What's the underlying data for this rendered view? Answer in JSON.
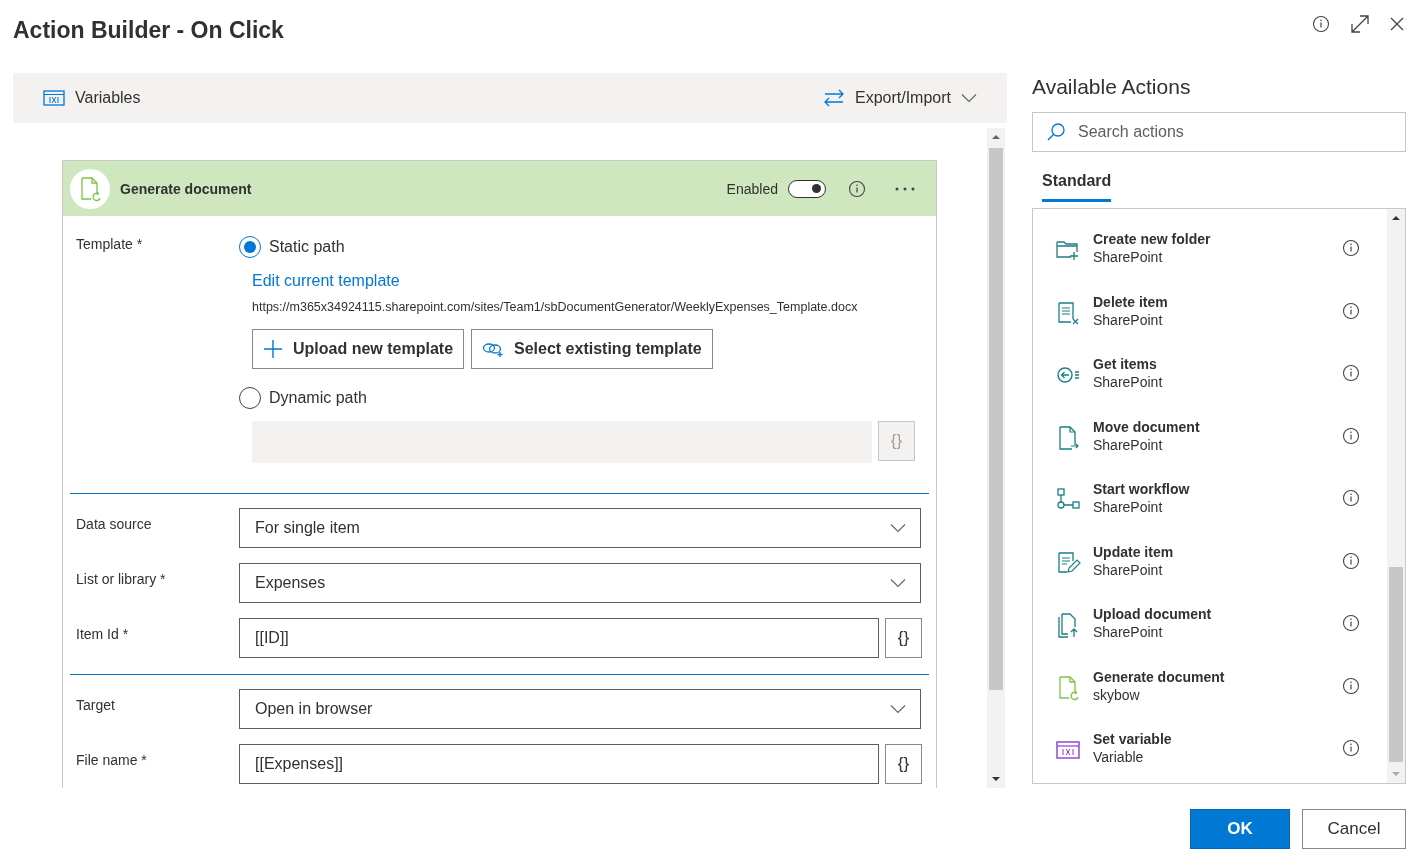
{
  "window": {
    "title": "Action Builder - On Click"
  },
  "toolbar": {
    "variables": "Variables",
    "export_import": "Export/Import"
  },
  "action_card": {
    "title": "Generate document",
    "enabled_label": "Enabled",
    "enabled": true,
    "template": {
      "label": "Template *",
      "options": [
        {
          "label": "Static path",
          "selected": true
        },
        {
          "label": "Dynamic path",
          "selected": false
        }
      ],
      "edit_link": "Edit current template",
      "url": "https://m365x34924115.sharepoint.com/sites/Team1/sbDocumentGenerator/WeeklyExpenses_Template.docx",
      "upload_button": "Upload new template",
      "select_button": "Select extisting template",
      "brace_button": "{}"
    },
    "sections": [
      {
        "fields": [
          {
            "kind": "dropdown",
            "label": "Data source",
            "value": "For single item"
          },
          {
            "kind": "dropdown",
            "label": "List or library *",
            "value": "Expenses"
          },
          {
            "kind": "input",
            "label": "Item Id *",
            "value": "[[ID]]",
            "button": "{}"
          }
        ]
      },
      {
        "fields": [
          {
            "kind": "dropdown",
            "label": "Target",
            "value": "Open in browser"
          },
          {
            "kind": "input",
            "label": "File name *",
            "value": "[[Expenses]]",
            "button": "{}"
          }
        ]
      }
    ]
  },
  "available_actions": {
    "title": "Available Actions",
    "search": {
      "placeholder": "Search actions"
    },
    "tabs": [
      {
        "label": "Standard",
        "selected": true
      }
    ],
    "items": [
      {
        "kind": "folder",
        "name": "Create new folder",
        "source": "SharePoint"
      },
      {
        "kind": "delete",
        "name": "Delete item",
        "source": "SharePoint"
      },
      {
        "kind": "get",
        "name": "Get items",
        "source": "SharePoint"
      },
      {
        "kind": "move",
        "name": "Move document",
        "source": "SharePoint"
      },
      {
        "kind": "workflow",
        "name": "Start workflow",
        "source": "SharePoint"
      },
      {
        "kind": "update",
        "name": "Update item",
        "source": "SharePoint"
      },
      {
        "kind": "upload",
        "name": "Upload document",
        "source": "SharePoint"
      },
      {
        "kind": "generate",
        "name": "Generate document",
        "source": "skybow"
      },
      {
        "kind": "variable",
        "name": "Set variable",
        "source": "Variable"
      }
    ]
  },
  "buttons": {
    "ok": "OK",
    "cancel": "Cancel"
  }
}
